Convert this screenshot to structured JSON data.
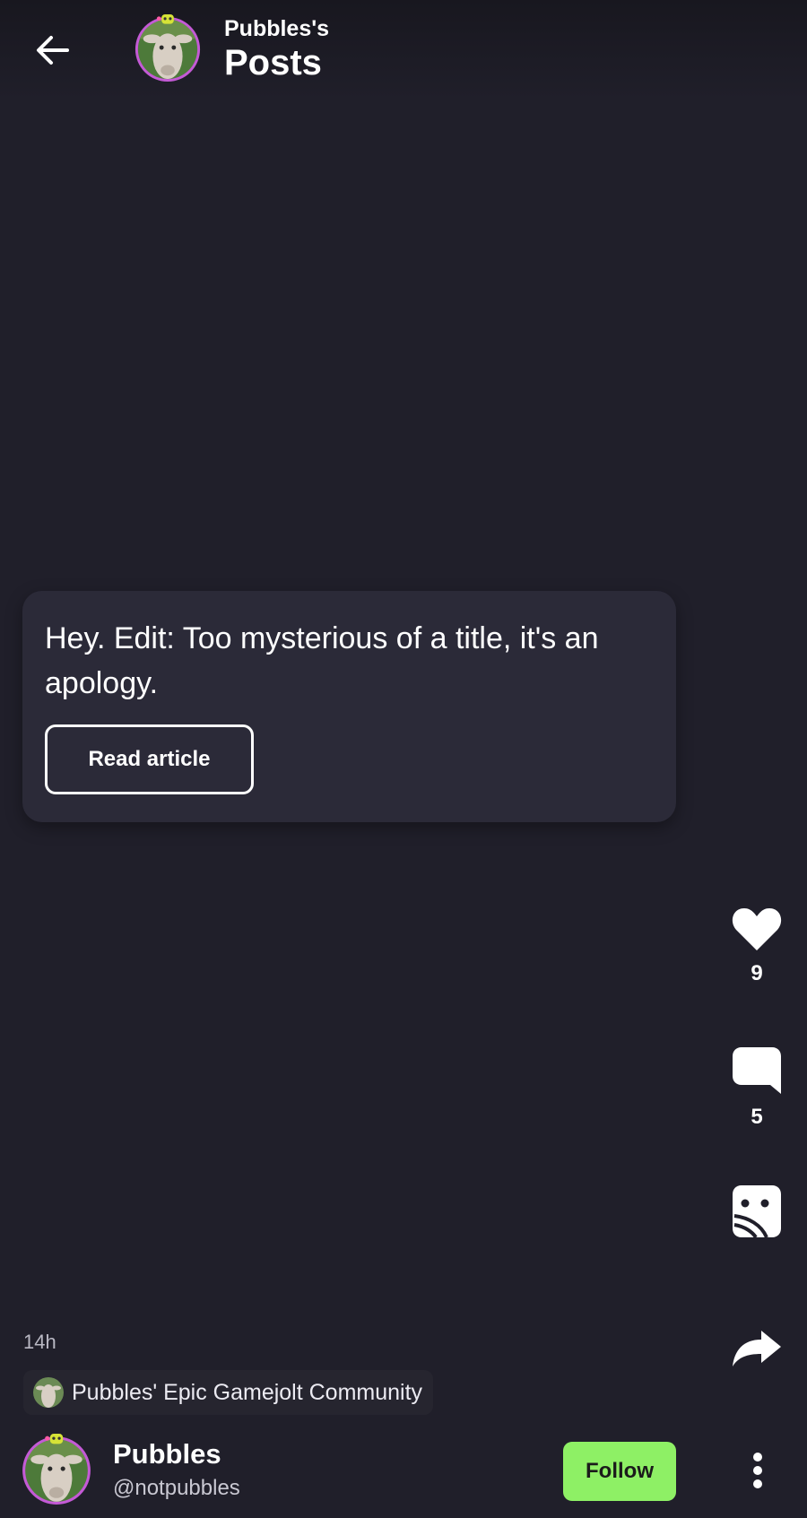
{
  "header": {
    "subtitle": "Pubbles's",
    "title": "Posts"
  },
  "post": {
    "title": "Hey. Edit: Too mysterious of a title, it's an apology.",
    "read_label": "Read article",
    "time": "14h",
    "community": "Pubbles' Epic Gamejolt Community"
  },
  "actions": {
    "likes": "9",
    "comments": "5"
  },
  "author": {
    "name": "Pubbles",
    "handle": "@notpubbles",
    "follow_label": "Follow"
  },
  "colors": {
    "background": "#201f2a",
    "card": "#2b2a38",
    "follow": "#8ef065",
    "avatar_ring": "#c45ad6"
  },
  "icons": [
    "arrow-left-icon",
    "heart-icon",
    "comment-icon",
    "sticker-icon",
    "share-icon",
    "more-vertical-icon"
  ]
}
